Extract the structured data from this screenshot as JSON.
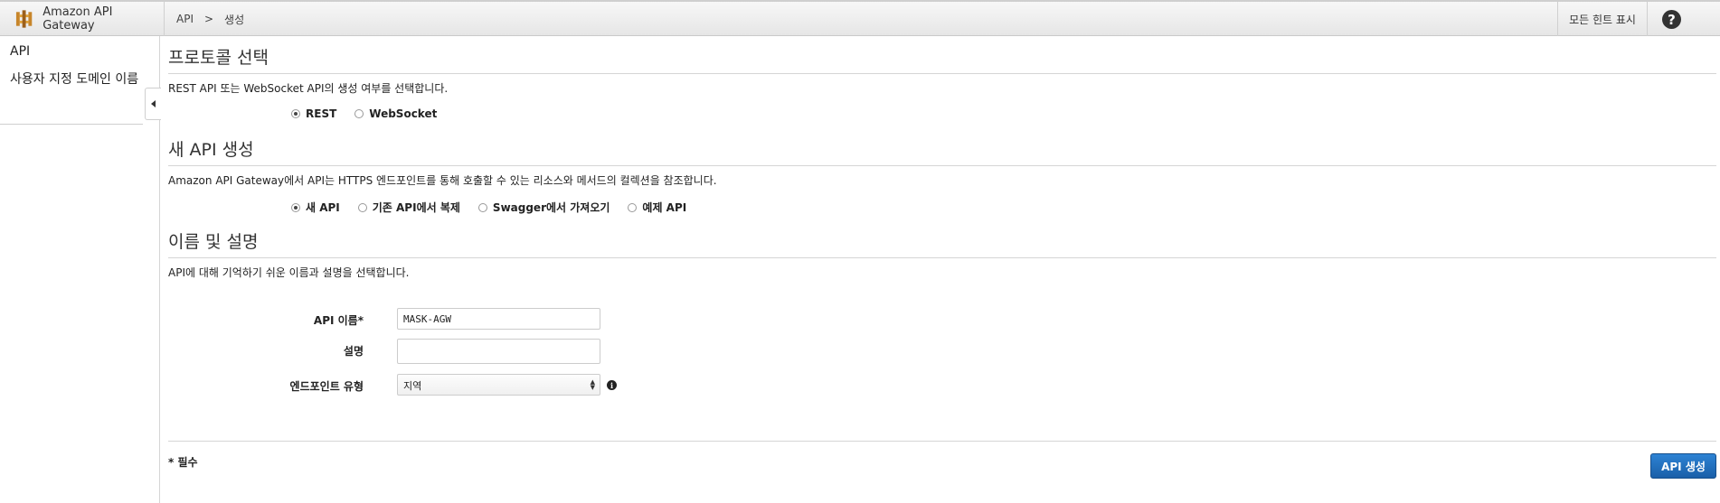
{
  "header": {
    "app_title": "Amazon API Gateway",
    "breadcrumb": {
      "root": "API",
      "separator": ">",
      "current": "생성"
    },
    "show_hints": "모든 힌트 표시",
    "help_icon": "?"
  },
  "sidebar": {
    "items": [
      {
        "label": "API"
      },
      {
        "label": "사용자 지정 도메인 이름"
      }
    ]
  },
  "protocol": {
    "title": "프로토콜 선택",
    "description": "REST API 또는 WebSocket API의 생성 여부를 선택합니다.",
    "options": [
      {
        "label": "REST",
        "checked": true
      },
      {
        "label": "WebSocket",
        "checked": false
      }
    ]
  },
  "new_api": {
    "title": "새 API 생성",
    "description": "Amazon API Gateway에서 API는 HTTPS 엔드포인트를 통해 호출할 수 있는 리소스와 메서드의 컬렉션을 참조합니다.",
    "options": [
      {
        "label": "새 API",
        "checked": true
      },
      {
        "label": "기존 API에서 복제",
        "checked": false
      },
      {
        "label": "Swagger에서 가져오기",
        "checked": false
      },
      {
        "label": "예제 API",
        "checked": false
      }
    ]
  },
  "name_desc": {
    "title": "이름 및 설명",
    "description": "API에 대해 기억하기 쉬운 이름과 설명을 선택합니다.",
    "api_name_label": "API 이름*",
    "api_name_value": "MASK-AGW",
    "description_label": "설명",
    "description_value": "",
    "endpoint_label": "엔드포인트 유형",
    "endpoint_value": "지역"
  },
  "footer": {
    "required_note": "* 필수",
    "create_button": "API 생성"
  },
  "colors": {
    "primary_button": "#1a5fa8",
    "topbar": "#ececec"
  }
}
